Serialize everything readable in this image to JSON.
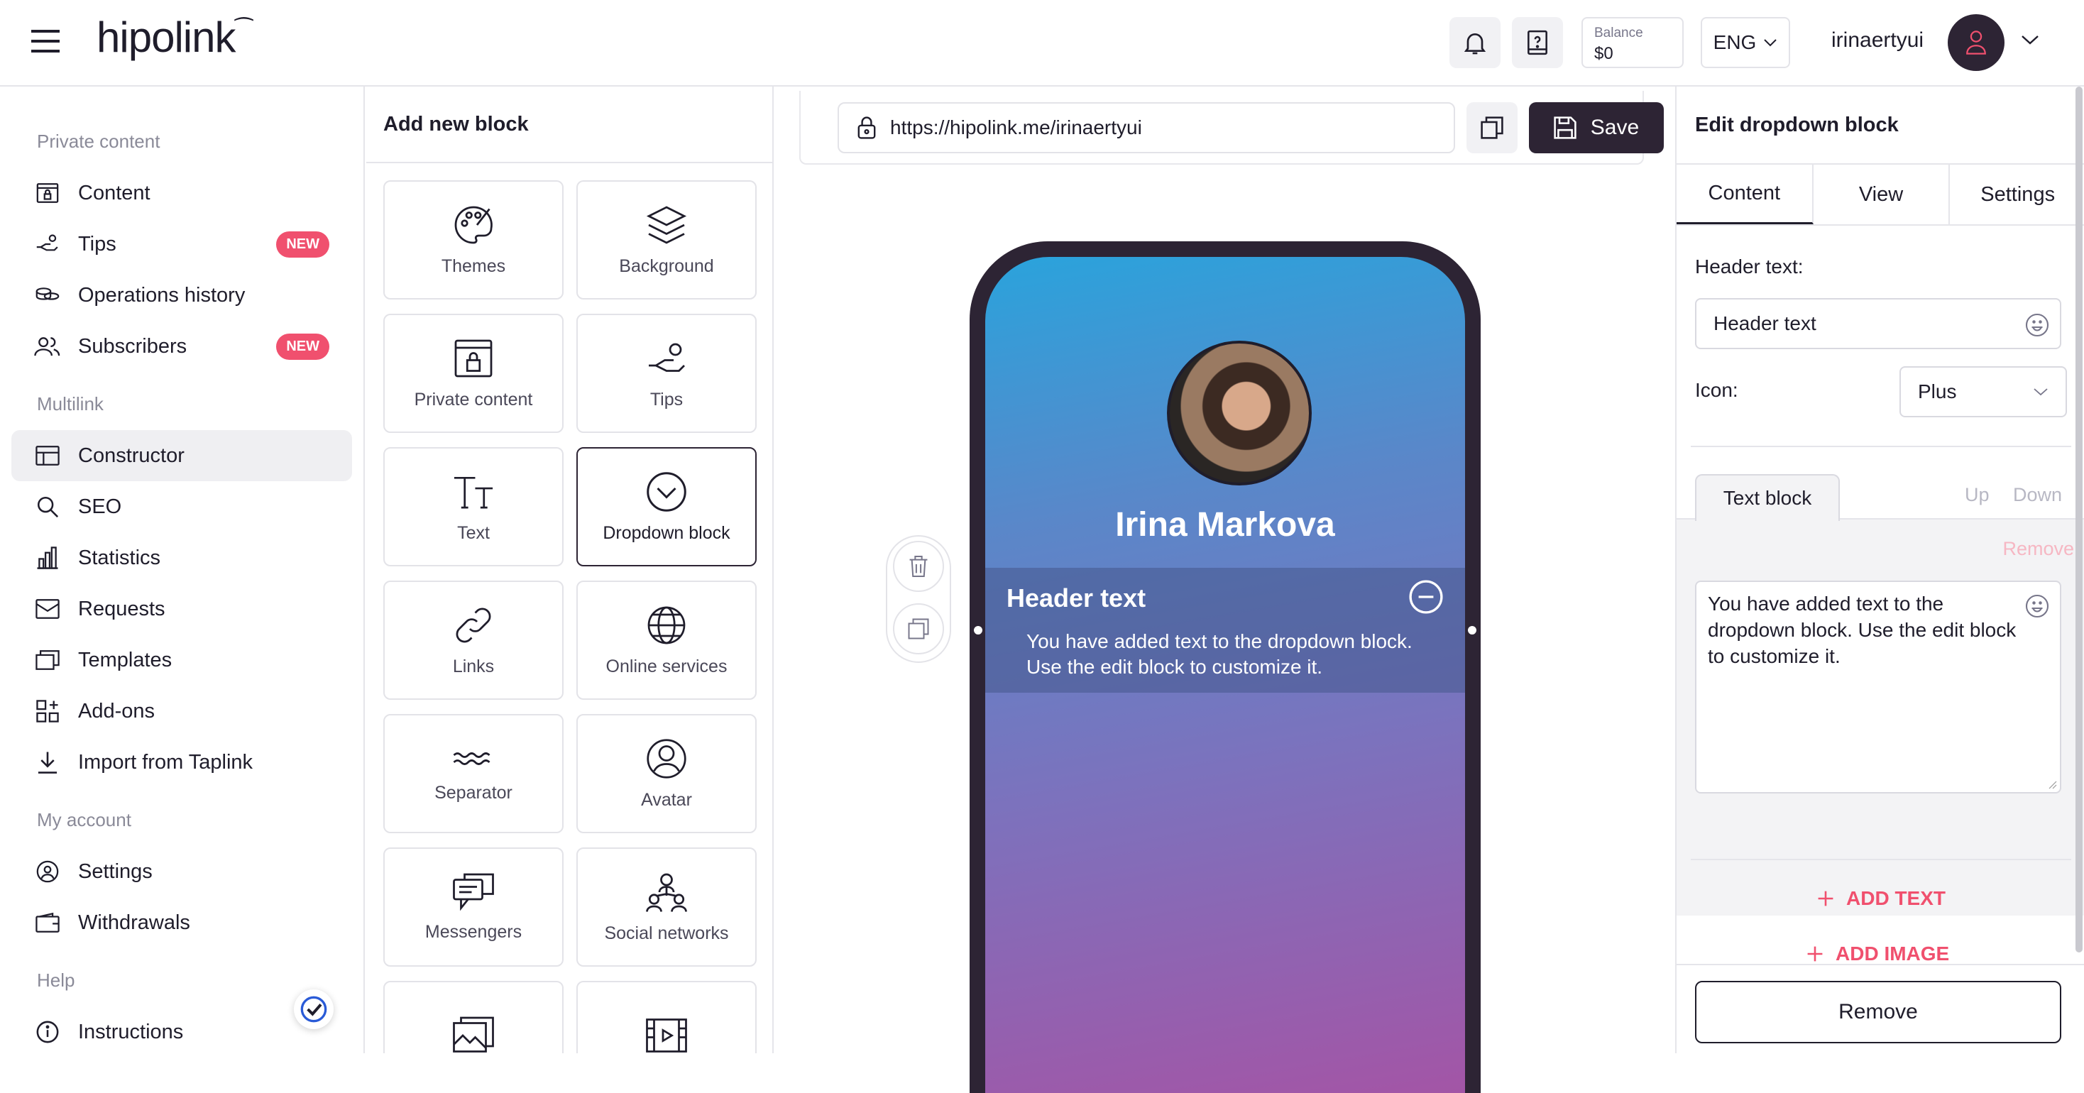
{
  "app": {
    "logo": "hipolink"
  },
  "header": {
    "balance_label": "Balance",
    "balance_value": "$0",
    "language": "ENG",
    "username": "irinaertyui"
  },
  "sidebar": {
    "section_private": "Private content",
    "section_multilink": "Multilink",
    "section_account": "My account",
    "section_help": "Help",
    "items": [
      {
        "label": "Content"
      },
      {
        "label": "Tips",
        "badge": "NEW"
      },
      {
        "label": "Operations history"
      },
      {
        "label": "Subscribers",
        "badge": "NEW"
      },
      {
        "label": "Constructor"
      },
      {
        "label": "SEO"
      },
      {
        "label": "Statistics"
      },
      {
        "label": "Requests"
      },
      {
        "label": "Templates"
      },
      {
        "label": "Add-ons"
      },
      {
        "label": "Import from Taplink"
      },
      {
        "label": "Settings"
      },
      {
        "label": "Withdrawals"
      },
      {
        "label": "Instructions"
      }
    ]
  },
  "blocks": {
    "title": "Add new block",
    "tiles": [
      {
        "label": "Themes",
        "icon": "palette-icon"
      },
      {
        "label": "Background",
        "icon": "layers-icon"
      },
      {
        "label": "Private content",
        "icon": "lock-window-icon"
      },
      {
        "label": "Tips",
        "icon": "hand-coins-icon"
      },
      {
        "label": "Text",
        "icon": "text-icon"
      },
      {
        "label": "Dropdown block",
        "icon": "chevron-circle-icon"
      },
      {
        "label": "Links",
        "icon": "link-icon"
      },
      {
        "label": "Online services",
        "icon": "globe-icon"
      },
      {
        "label": "Separator",
        "icon": "wave-icon"
      },
      {
        "label": "Avatar",
        "icon": "user-circle-icon"
      },
      {
        "label": "Messengers",
        "icon": "chat-icon"
      },
      {
        "label": "Social networks",
        "icon": "network-icon"
      },
      {
        "label": "",
        "icon": "images-icon"
      },
      {
        "label": "",
        "icon": "video-icon"
      }
    ]
  },
  "editor": {
    "url": "https://hipolink.me/irinaertyui",
    "save_label": "Save",
    "profile_name": "Irina Markova",
    "dropdown_header": "Header text",
    "dropdown_body": "You have added text to the dropdown block. Use the edit block to customize it."
  },
  "edit_panel": {
    "title": "Edit dropdown block",
    "tabs": [
      "Content",
      "View",
      "Settings"
    ],
    "header_text_label": "Header text:",
    "header_text_value": "Header text",
    "icon_label": "Icon:",
    "icon_value": "Plus",
    "text_block_tab": "Text block",
    "up": "Up",
    "down": "Down",
    "remove_small": "Remove",
    "text_value": "You have added text to the dropdown block. Use the edit block to customize it.",
    "add_text": "ADD TEXT",
    "add_image": "ADD IMAGE",
    "remove": "Remove"
  },
  "colors": {
    "accent": "#f0506e",
    "dark": "#2d2434"
  }
}
